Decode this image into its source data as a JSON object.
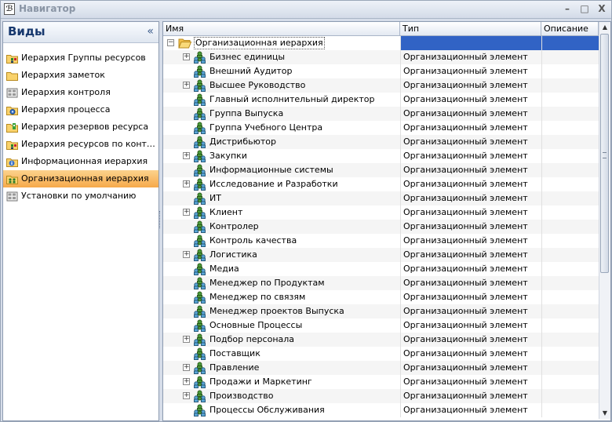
{
  "window": {
    "title": "Навигатор",
    "minimize": "–",
    "maximize": "□",
    "close": "X"
  },
  "left": {
    "title": "Виды",
    "collapse": "«",
    "items": [
      {
        "label": "Иерархия Группы ресурсов",
        "icon": "folder-grid-icon"
      },
      {
        "label": "Иерархия заметок",
        "icon": "folder-icon"
      },
      {
        "label": "Иерархия контроля",
        "icon": "grid-icon"
      },
      {
        "label": "Иерархия процесса",
        "icon": "gear-folder-icon"
      },
      {
        "label": "Иерархия резервов ресурса",
        "icon": "folder-green-icon"
      },
      {
        "label": "Иерархия ресурсов по контрол...",
        "icon": "folder-grid-icon"
      },
      {
        "label": "Информационная иерархия",
        "icon": "info-folder-icon"
      },
      {
        "label": "Организационная иерархия",
        "icon": "org-folder-icon",
        "selected": true
      },
      {
        "label": "Установки по умолчанию",
        "icon": "grid-icon"
      }
    ]
  },
  "grid": {
    "columns": {
      "name": "Имя",
      "type": "Тип",
      "desc": "Описание"
    },
    "root": {
      "label": "Организационная иерархия",
      "expander": "−"
    },
    "rows": [
      {
        "name": "Бизнес единицы",
        "type": "Организационный элемент",
        "exp": "+"
      },
      {
        "name": "Внешний Аудитор",
        "type": "Организационный элемент",
        "exp": ""
      },
      {
        "name": "Высшее Руководство",
        "type": "Организационный элемент",
        "exp": "+"
      },
      {
        "name": "Главный исполнительный директор",
        "type": "Организационный элемент",
        "exp": ""
      },
      {
        "name": "Группа Выпуска",
        "type": "Организационный элемент",
        "exp": ""
      },
      {
        "name": "Группа Учебного Центра",
        "type": "Организационный элемент",
        "exp": ""
      },
      {
        "name": "Дистрибьютор",
        "type": "Организационный элемент",
        "exp": ""
      },
      {
        "name": "Закупки",
        "type": "Организационный элемент",
        "exp": "+"
      },
      {
        "name": "Информационные системы",
        "type": "Организационный элемент",
        "exp": ""
      },
      {
        "name": "Исследование и Разработки",
        "type": "Организационный элемент",
        "exp": "+"
      },
      {
        "name": "ИТ",
        "type": "Организационный элемент",
        "exp": ""
      },
      {
        "name": "Клиент",
        "type": "Организационный элемент",
        "exp": "+"
      },
      {
        "name": "Контролер",
        "type": "Организационный элемент",
        "exp": ""
      },
      {
        "name": "Контроль качества",
        "type": "Организационный элемент",
        "exp": ""
      },
      {
        "name": "Логистика",
        "type": "Организационный элемент",
        "exp": "+"
      },
      {
        "name": "Медиа",
        "type": "Организационный элемент",
        "exp": ""
      },
      {
        "name": "Менеджер по Продуктам",
        "type": "Организационный элемент",
        "exp": ""
      },
      {
        "name": "Менеджер по связям",
        "type": "Организационный элемент",
        "exp": ""
      },
      {
        "name": "Менеджер проектов Выпуска",
        "type": "Организационный элемент",
        "exp": ""
      },
      {
        "name": "Основные Процессы",
        "type": "Организационный элемент",
        "exp": ""
      },
      {
        "name": "Подбор персонала",
        "type": "Организационный элемент",
        "exp": "+"
      },
      {
        "name": "Поставщик",
        "type": "Организационный элемент",
        "exp": ""
      },
      {
        "name": "Правление",
        "type": "Организационный элемент",
        "exp": "+"
      },
      {
        "name": "Продажи и Маркетинг",
        "type": "Организационный элемент",
        "exp": "+"
      },
      {
        "name": "Производство",
        "type": "Организационный элемент",
        "exp": "+"
      },
      {
        "name": "Процессы Обслуживания",
        "type": "Организационный элемент",
        "exp": ""
      }
    ]
  },
  "scrollbar": {
    "up": "▲",
    "down": "▼",
    "position": 0.0
  },
  "colors": {
    "selection": "#3163c5",
    "selected_nav": "#f6a94a",
    "header_text": "#17386e"
  }
}
